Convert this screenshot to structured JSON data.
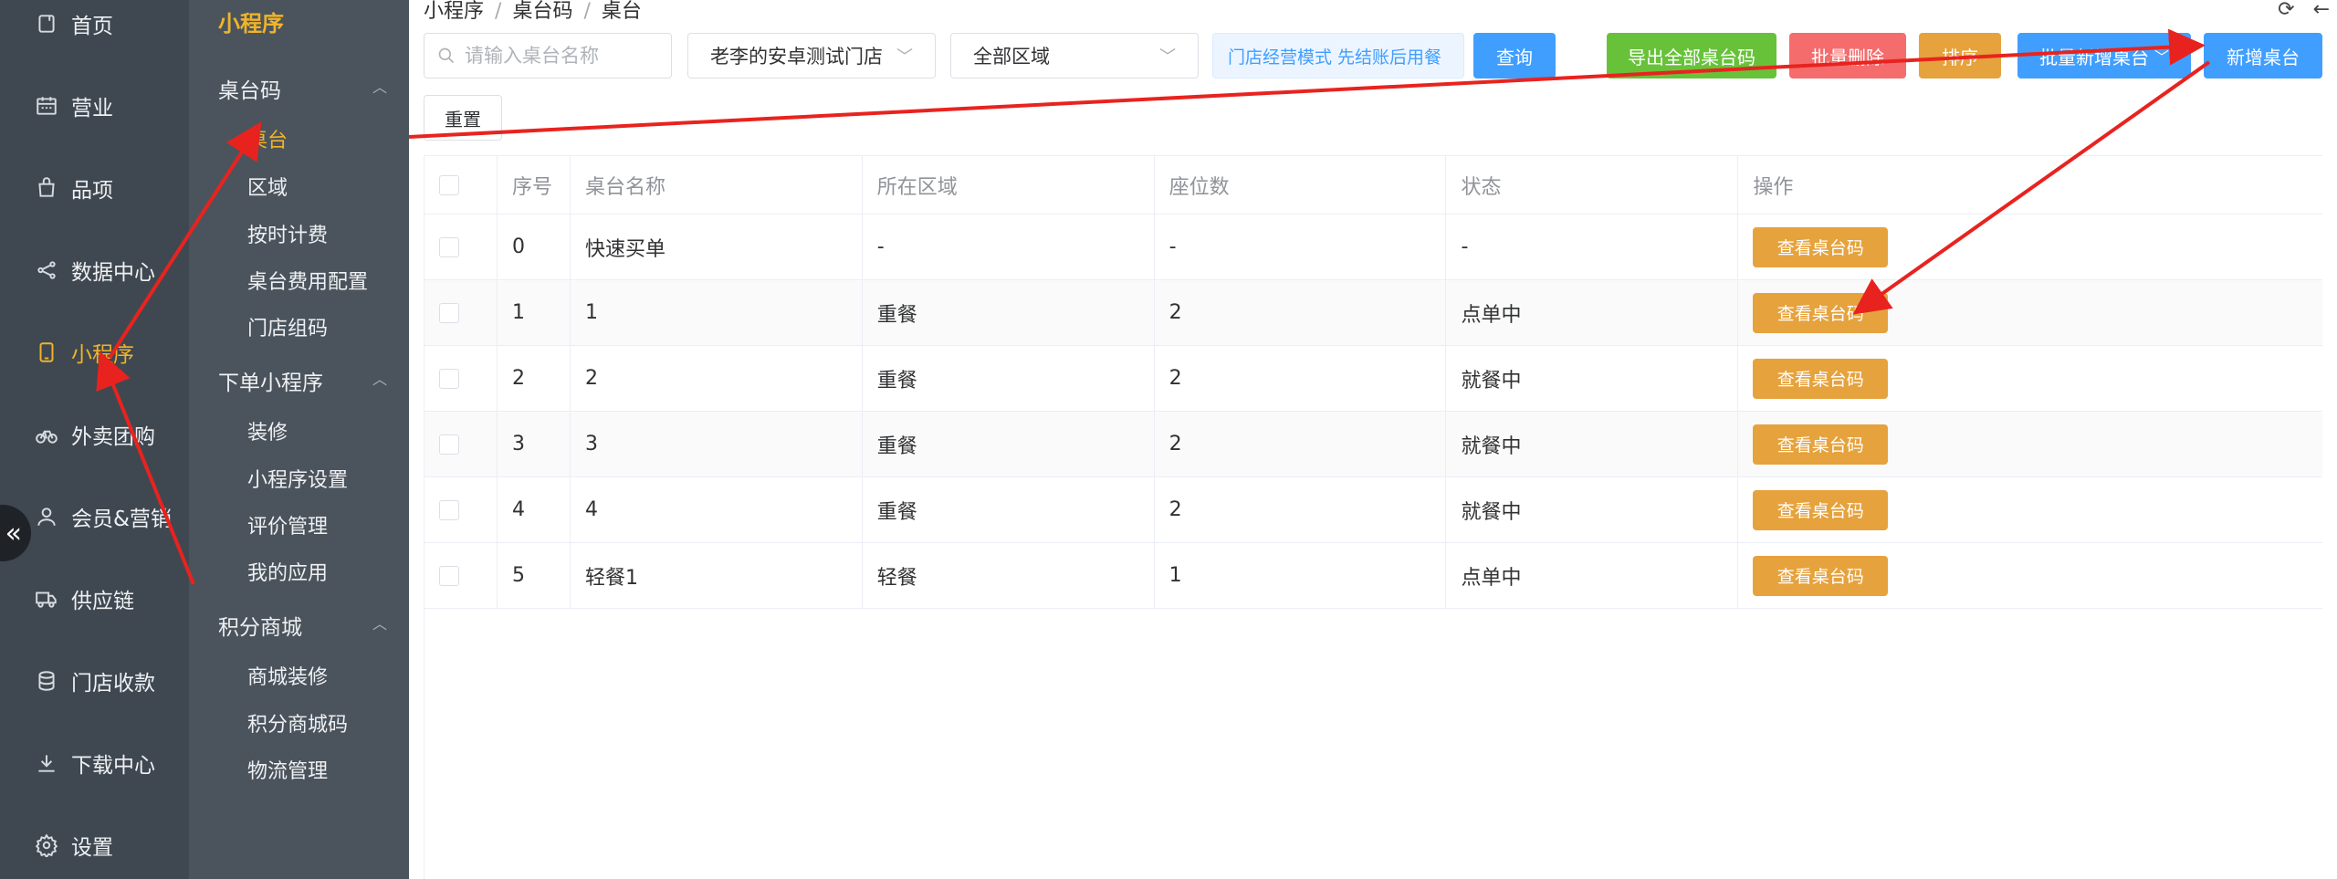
{
  "mainnav": {
    "items": [
      {
        "label": "首页",
        "icon": "home-icon"
      },
      {
        "label": "营业",
        "icon": "calendar-icon"
      },
      {
        "label": "品项",
        "icon": "bag-icon"
      },
      {
        "label": "数据中心",
        "icon": "share-icon"
      },
      {
        "label": "小程序",
        "icon": "tablet-icon",
        "active": true
      },
      {
        "label": "外卖团购",
        "icon": "bike-icon"
      },
      {
        "label": "会员&营销",
        "icon": "user-icon"
      },
      {
        "label": "供应链",
        "icon": "truck-icon"
      },
      {
        "label": "门店收款",
        "icon": "database-icon"
      },
      {
        "label": "下载中心",
        "icon": "download-icon"
      },
      {
        "label": "设置",
        "icon": "gear-icon"
      }
    ],
    "collapse_label": "«"
  },
  "subnav": {
    "title": "小程序",
    "groups": [
      {
        "label": "桌台码",
        "caret": "︿",
        "items": [
          "桌台",
          "区域",
          "按时计费",
          "桌台费用配置",
          "门店组码"
        ]
      },
      {
        "label": "下单小程序",
        "caret": "︿",
        "items": [
          "装修",
          "小程序设置",
          "评价管理",
          "我的应用"
        ]
      },
      {
        "label": "积分商城",
        "caret": "︿",
        "items": [
          "商城装修",
          "积分商城码",
          "物流管理"
        ]
      }
    ]
  },
  "breadcrumb": [
    "小程序",
    "桌台码",
    "桌台"
  ],
  "top_icons": {
    "refresh": "⟳",
    "back": "←"
  },
  "filters": {
    "search_placeholder": "请输入桌台名称",
    "store": "老李的安卓测试门店",
    "area": "全部区域",
    "notice": "门店经营模式 先结账后用餐",
    "query": "查询",
    "reset": "重置"
  },
  "actions": {
    "export": "导出全部桌台码",
    "batch_delete": "批量删除",
    "sort": "排序",
    "batch_add": "批量新增桌台",
    "add": "新增桌台",
    "colors": {
      "export": "#67c23a",
      "batch_delete": "#f56c6c",
      "sort": "#e6a23c",
      "batch_add": "#409eff",
      "add": "#409eff"
    }
  },
  "table": {
    "headers": [
      "序号",
      "桌台名称",
      "所在区域",
      "座位数",
      "状态",
      "操作"
    ],
    "rows": [
      {
        "no": "0",
        "name": "快速买单",
        "area": "-",
        "seats": "-",
        "status": "-",
        "op": "查看桌台码"
      },
      {
        "no": "1",
        "name": "1",
        "area": "重餐",
        "seats": "2",
        "status": "点单中",
        "op": "查看桌台码"
      },
      {
        "no": "2",
        "name": "2",
        "area": "重餐",
        "seats": "2",
        "status": "就餐中",
        "op": "查看桌台码"
      },
      {
        "no": "3",
        "name": "3",
        "area": "重餐",
        "seats": "2",
        "status": "就餐中",
        "op": "查看桌台码"
      },
      {
        "no": "4",
        "name": "4",
        "area": "重餐",
        "seats": "2",
        "status": "就餐中",
        "op": "查看桌台码"
      },
      {
        "no": "5",
        "name": "轻餐1",
        "area": "轻餐",
        "seats": "1",
        "status": "点单中",
        "op": "查看桌台码"
      }
    ]
  }
}
